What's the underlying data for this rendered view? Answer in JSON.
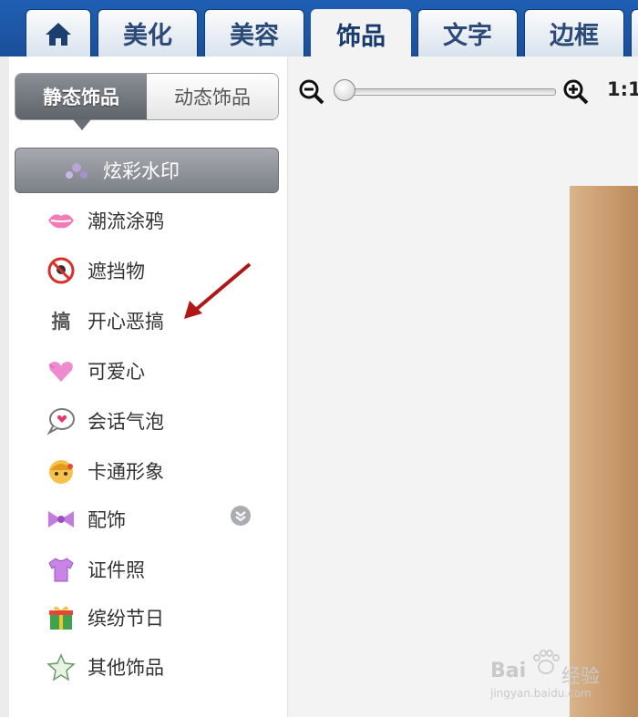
{
  "tabs": [
    {
      "id": "home",
      "label": "",
      "icon": "home-icon"
    },
    {
      "id": "beautify",
      "label": "美化"
    },
    {
      "id": "beauty",
      "label": "美容"
    },
    {
      "id": "accessories",
      "label": "饰品",
      "active": true
    },
    {
      "id": "text",
      "label": "文字"
    },
    {
      "id": "border",
      "label": "边框"
    }
  ],
  "segment": {
    "static_label": "静态饰品",
    "dynamic_label": "动态饰品",
    "selected": "static"
  },
  "categories": [
    {
      "label": "炫彩水印",
      "icon": "sparkle-icon",
      "selected": true
    },
    {
      "label": "潮流涂鸦",
      "icon": "lips-icon"
    },
    {
      "label": "遮挡物",
      "icon": "prohibited-icon"
    },
    {
      "label": "开心恶搞",
      "icon": "text-glyph-icon",
      "glyph": "搞"
    },
    {
      "label": "可爱心",
      "icon": "heart-icon"
    },
    {
      "label": "会话气泡",
      "icon": "speech-bubble-icon"
    },
    {
      "label": "卡通形象",
      "icon": "cartoon-face-icon"
    },
    {
      "label": "配饰",
      "icon": "bow-icon",
      "has_expand": true
    },
    {
      "label": "证件照",
      "icon": "shirt-icon"
    },
    {
      "label": "缤纷节日",
      "icon": "gift-icon"
    },
    {
      "label": "其他饰品",
      "icon": "star-icon"
    }
  ],
  "zoom": {
    "label": "1:1",
    "slider_level": 0.0
  },
  "watermark": {
    "brand": "Bai",
    "suffix": "经验",
    "url": "jingyan.baidu.com"
  },
  "colors": {
    "tab_bar": "#1f5fb4",
    "arrow": "#b01818",
    "selected_item": "#8a8f96"
  }
}
